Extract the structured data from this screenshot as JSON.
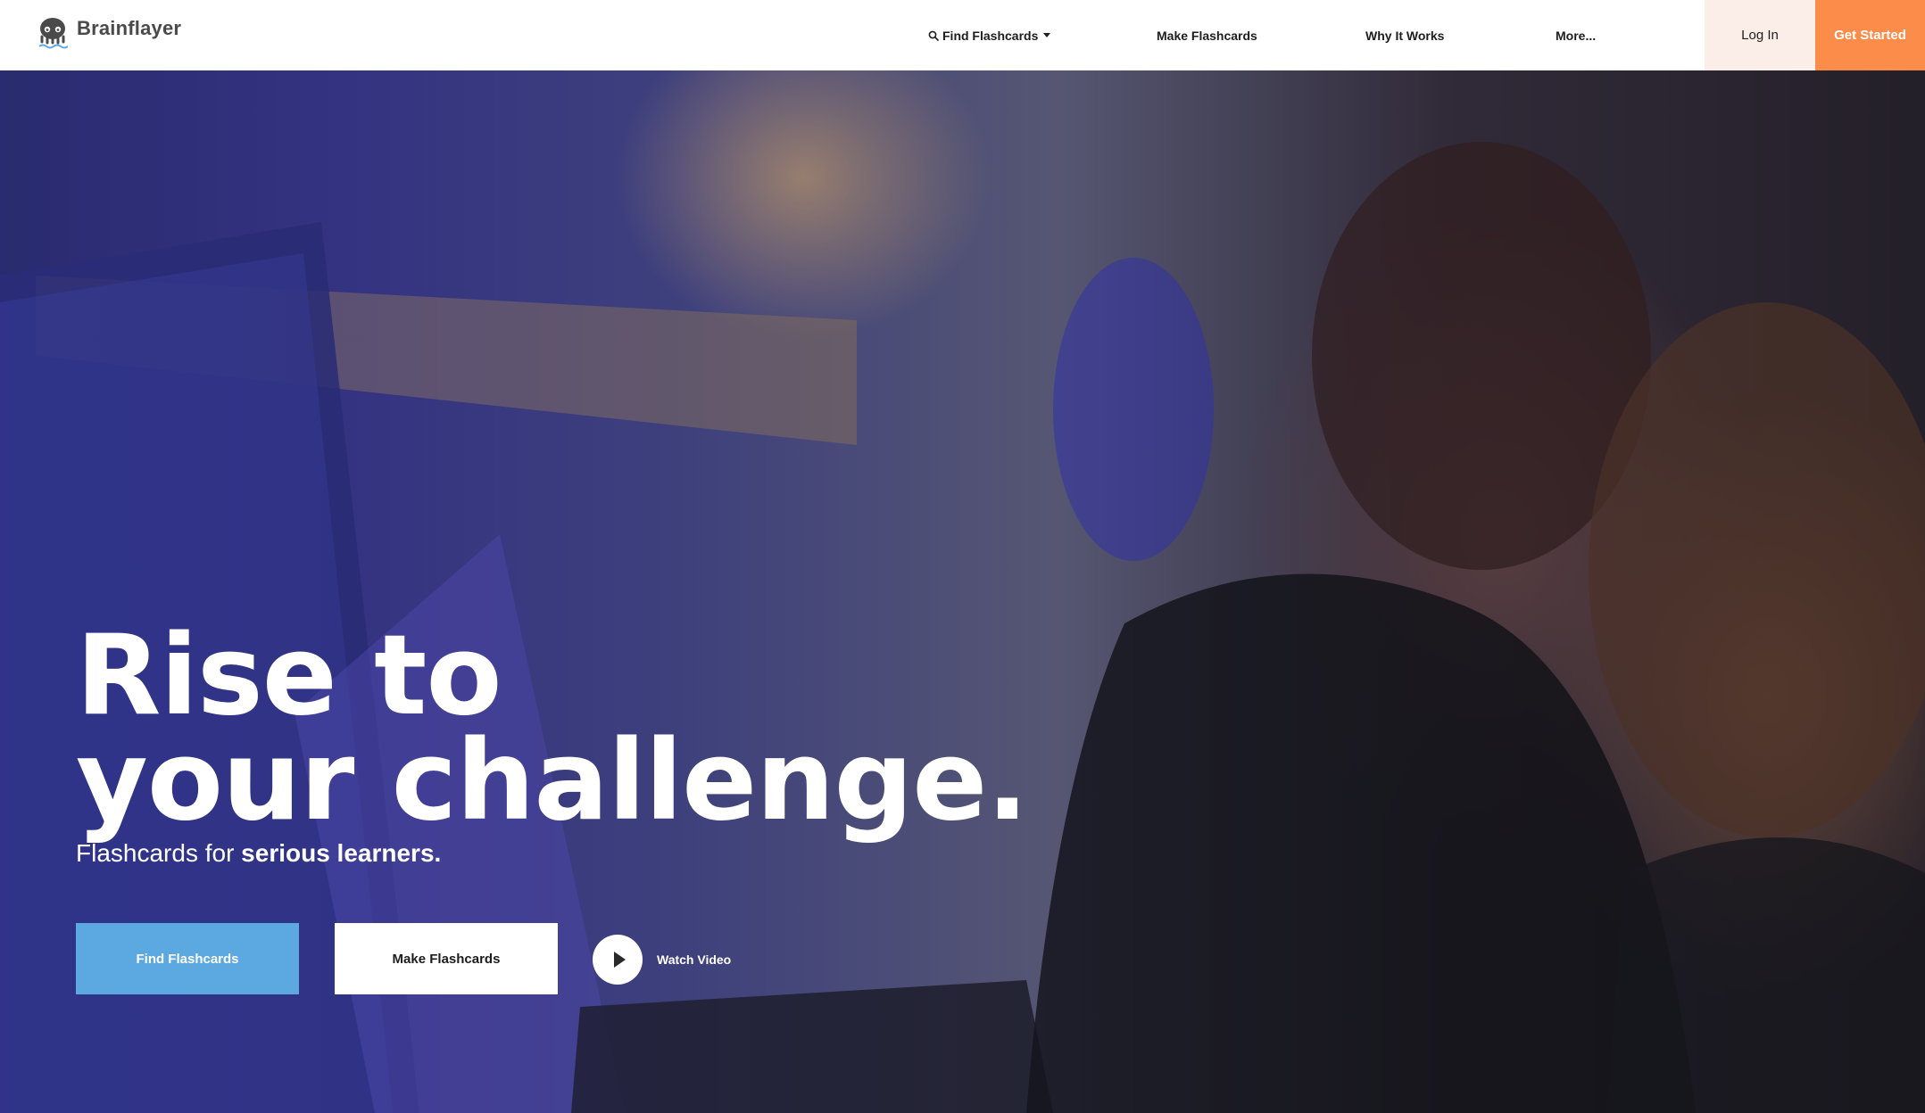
{
  "brand": {
    "name": "Brainflayer",
    "logo_icon": "octopus-brain-icon"
  },
  "nav": {
    "search_icon": "search-icon",
    "find": "Find Flashcards",
    "make": "Make Flashcards",
    "why": "Why It Works",
    "more": "More...",
    "login": "Log In",
    "get_started": "Get Started"
  },
  "hero": {
    "title_line1": "Rise to",
    "title_line2": "your challenge.",
    "subtitle_prefix": "Flashcards for ",
    "subtitle_bold": "serious learners.",
    "btn_find": "Find Flashcards",
    "btn_make": "Make Flashcards",
    "watch_icon": "play-icon",
    "watch_label": "Watch Video"
  },
  "colors": {
    "accent_orange": "#fb8c4a",
    "login_bg": "#fbeee8",
    "button_blue": "#5ca8e0",
    "logo_gray": "#4a4a4a"
  }
}
